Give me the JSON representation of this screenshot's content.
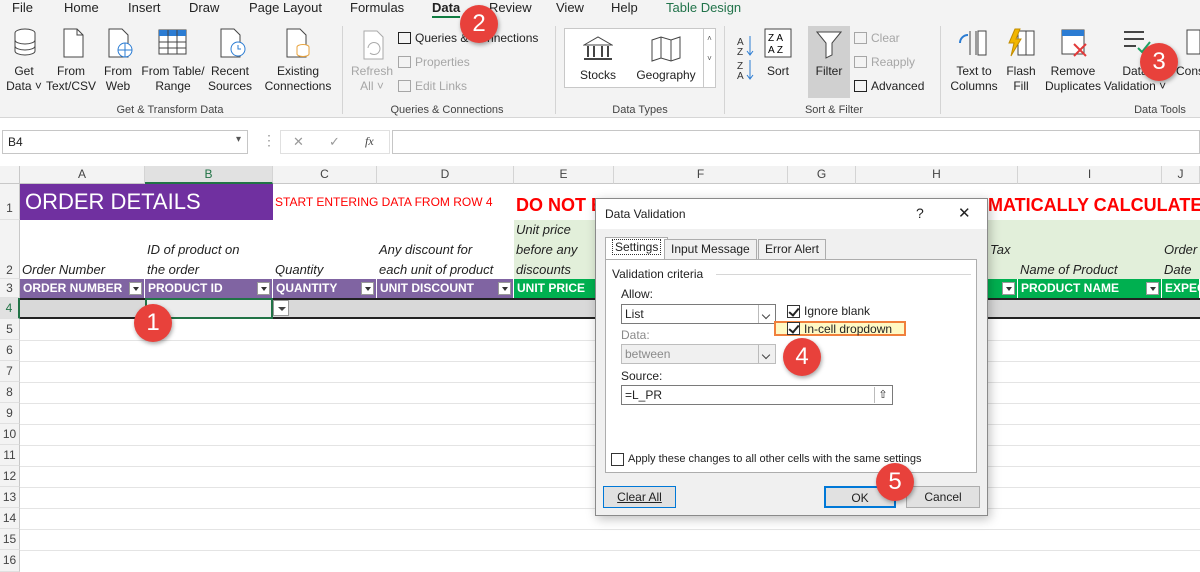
{
  "menu": {
    "items": [
      "File",
      "Home",
      "Insert",
      "Draw",
      "Page Layout",
      "Formulas",
      "Data",
      "Review",
      "View",
      "Help",
      "Table Design"
    ],
    "active": "Data"
  },
  "ribbon": {
    "get_transform": {
      "get_data": [
        "Get",
        "Data ˅"
      ],
      "from_text": [
        "From",
        "Text/CSV"
      ],
      "from_web": [
        "From",
        "Web"
      ],
      "from_table": [
        "From Table/",
        "Range"
      ],
      "recent_sources": [
        "Recent",
        "Sources"
      ],
      "existing_connections": [
        "Existing",
        "Connections"
      ],
      "label": "Get & Transform Data"
    },
    "queries": {
      "refresh_all": [
        "Refresh",
        "All ˅"
      ],
      "queries_connections": "Queries & Connections",
      "properties": "Properties",
      "edit_links": "Edit Links",
      "label": "Queries & Connections"
    },
    "data_types": {
      "stocks": "Stocks",
      "geography": "Geography",
      "label": "Data Types"
    },
    "sort_filter": {
      "sort": "Sort",
      "filter": "Filter",
      "clear": "Clear",
      "reapply": "Reapply",
      "advanced": "Advanced",
      "label": "Sort & Filter"
    },
    "data_tools": {
      "text_to_columns": [
        "Text to",
        "Columns"
      ],
      "flash_fill": [
        "Flash",
        "Fill"
      ],
      "remove_duplicates": [
        "Remove",
        "Duplicates"
      ],
      "data_validation": [
        "Data",
        "Validation ˅"
      ],
      "consolidate": "Cons",
      "label": "Data Tools"
    }
  },
  "formula_bar": {
    "name_box": "B4",
    "cancel": "✕",
    "enter": "✓",
    "fx": "fx",
    "formula": ""
  },
  "sheet": {
    "columns": [
      "A",
      "B",
      "C",
      "D",
      "E",
      "F",
      "G",
      "H",
      "I",
      "J"
    ],
    "selected_column": "B",
    "rows": [
      "1",
      "2",
      "3",
      "4",
      "5",
      "6",
      "7",
      "8",
      "9",
      "10",
      "11",
      "12",
      "13",
      "14",
      "15",
      "16"
    ],
    "selected_row": "4",
    "title": "ORDER DETAILS",
    "instruction": "START ENTERING DATA FROM ROW 4",
    "warning_left": "DO NOT E",
    "warning_right": "MATICALLY CALCULATED",
    "descriptions": {
      "a": "Order Number",
      "b": [
        "ID of product on",
        "the order"
      ],
      "c": "Quantity",
      "d": [
        "Any discount for",
        "each unit of product"
      ],
      "e": [
        "Unit price",
        "before any",
        "discounts"
      ],
      "h": "Tax",
      "i": "Name of Product",
      "j": [
        "Order",
        "Date"
      ]
    },
    "headers": {
      "a": "ORDER NUMBER",
      "b": "PRODUCT ID",
      "c": "QUANTITY",
      "d": "UNIT DISCOUNT",
      "e": "UNIT PRICE",
      "i": "PRODUCT NAME",
      "j": "EXPEC"
    },
    "colors": {
      "purple": "#7030a0",
      "lavender": "#8064a2",
      "green": "#00b050",
      "light_green": "#e2efda",
      "red": "#ff0000"
    }
  },
  "dialog": {
    "title": "Data Validation",
    "help": "?",
    "close": "✕",
    "tabs": [
      "Settings",
      "Input Message",
      "Error Alert"
    ],
    "section": "Validation criteria",
    "allow_label": "Allow:",
    "allow_value": "List",
    "ignore_blank": "Ignore blank",
    "in_cell_dropdown": "In-cell dropdown",
    "data_label": "Data:",
    "data_value": "between",
    "source_label": "Source:",
    "source_value": "=L_PR",
    "apply_all": "Apply these changes to all other cells with the same settings",
    "clear_all": "Clear All",
    "ok": "OK",
    "cancel": "Cancel"
  },
  "callouts": [
    "1",
    "2",
    "3",
    "4",
    "5"
  ]
}
